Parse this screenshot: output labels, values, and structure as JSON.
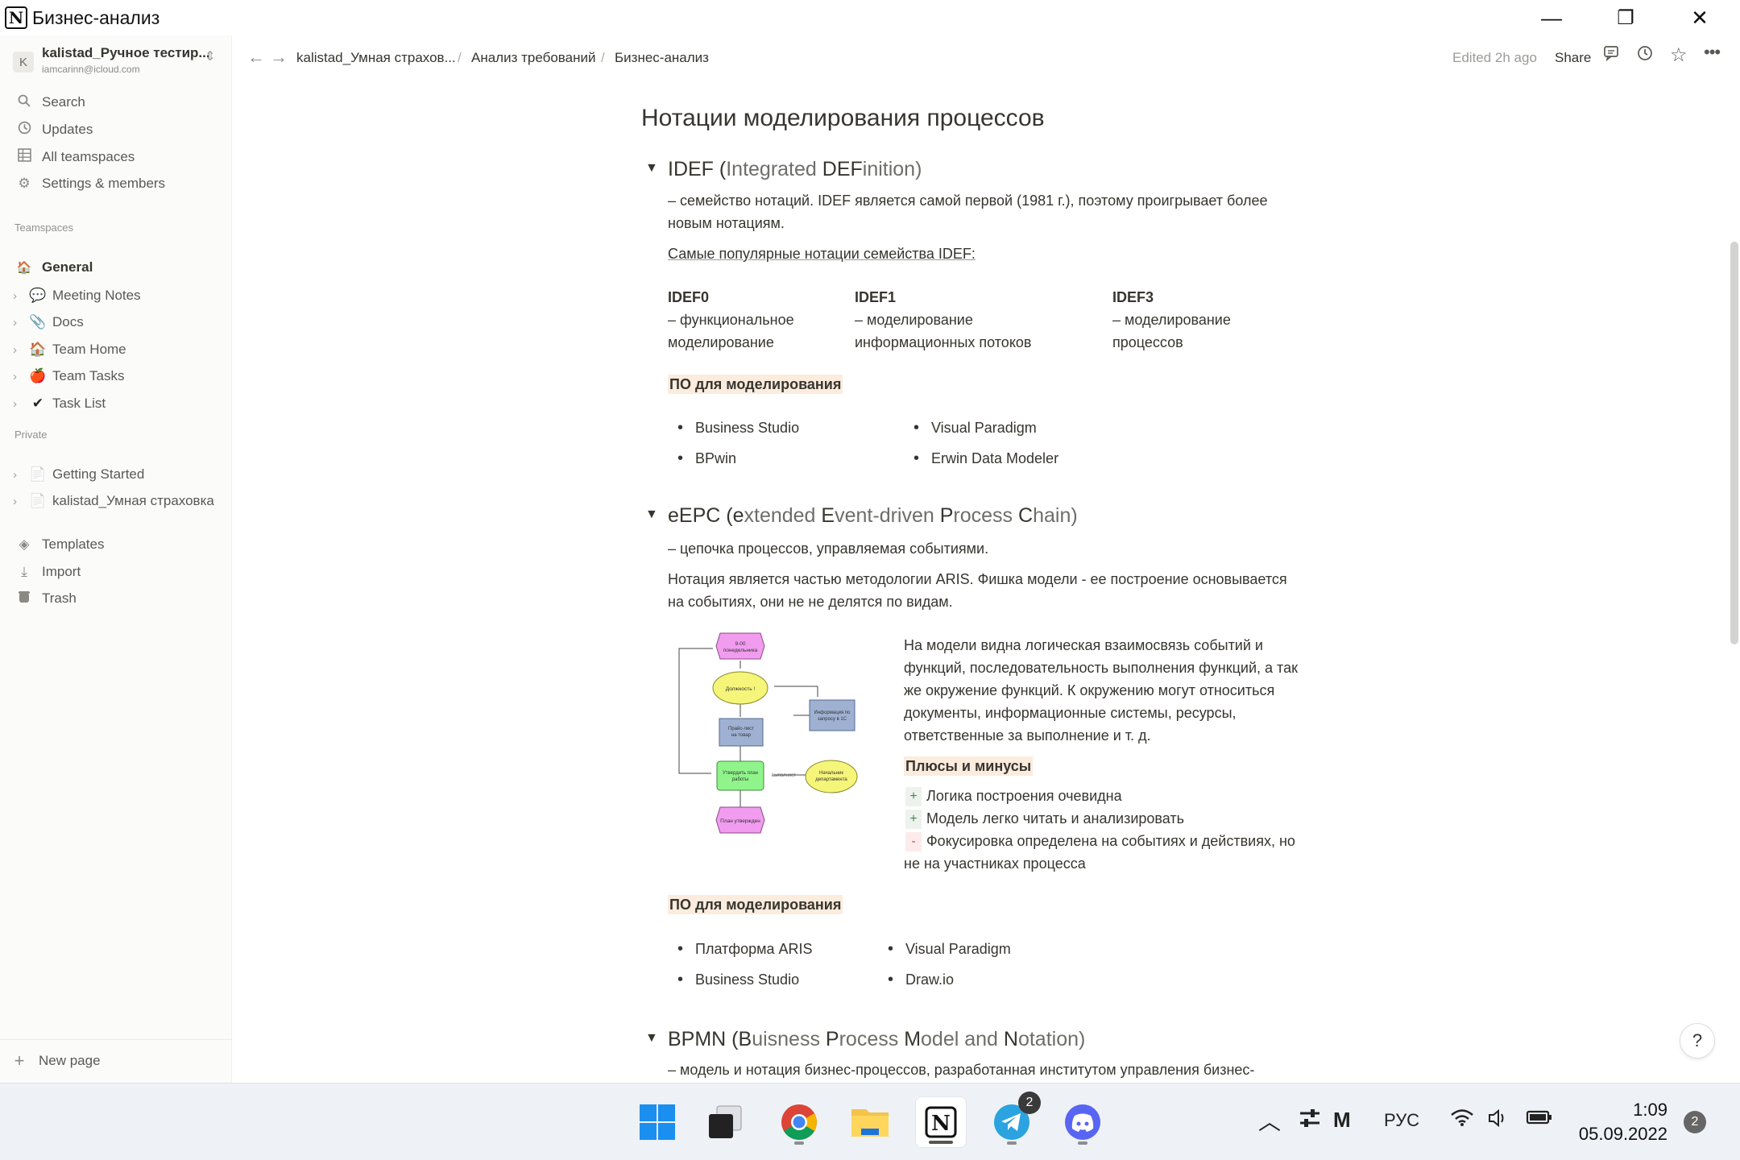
{
  "window": {
    "title": "Бизнес-анализ",
    "minimize": "—",
    "restore": "❐",
    "close": "✕"
  },
  "workspace": {
    "avatar": "K",
    "name": "kalistad_Ручное тестир...",
    "email": "iamcarinn@icloud.com"
  },
  "sidebar": {
    "top_items": [
      {
        "icon": "search-icon",
        "label": "Search"
      },
      {
        "icon": "clock-icon",
        "label": "Updates"
      },
      {
        "icon": "grid-icon",
        "label": "All teamspaces"
      },
      {
        "icon": "gear-icon",
        "label": "Settings & members"
      }
    ],
    "teamspaces_label": "Teamspaces",
    "teamspace_general": "General",
    "teamspace_items": [
      {
        "emoji": "💬",
        "label": "Meeting Notes"
      },
      {
        "emoji": "📎",
        "label": "Docs"
      },
      {
        "emoji": "🏠",
        "label": "Team Home"
      },
      {
        "emoji": "🍎",
        "label": "Team Tasks"
      },
      {
        "emoji": "✔",
        "label": "Task List"
      }
    ],
    "private_label": "Private",
    "private_items": [
      {
        "emoji": "📄",
        "label": "Getting Started"
      },
      {
        "emoji": "📄",
        "label": "kalistad_Умная страховка"
      }
    ],
    "bottom_items": [
      {
        "icon": "templates-icon",
        "label": "Templates"
      },
      {
        "icon": "import-icon",
        "label": "Import"
      },
      {
        "icon": "trash-icon",
        "label": "Trash"
      }
    ],
    "new_page": "New page"
  },
  "topbar": {
    "breadcrumbs": [
      "kalistad_Умная страхов...",
      "Анализ требований",
      "Бизнес-анализ"
    ],
    "edited": "Edited 2h ago",
    "share": "Share"
  },
  "page": {
    "title": "Нотации моделирования процессов",
    "idef": {
      "heading_pre": "IDEF (",
      "heading_i": "I",
      "heading_mid1": "ntegrated ",
      "heading_def": "DEF",
      "heading_end": "inition)",
      "desc1": " – семейство нотаций. IDEF является самой первой (1981 г.), поэтому проигрывает более",
      "desc2": "новым нотациям.",
      "popular": "Самые популярные нотации семейства IDEF:",
      "cols": [
        {
          "name": "IDEF0",
          "l1": " – функциональное",
          "l2": "моделирование"
        },
        {
          "name": "IDEF1",
          "l1": " –  моделирование",
          "l2": "информационных потоков"
        },
        {
          "name": "IDEF3",
          "l1": " – моделирование",
          "l2": "процессов"
        }
      ],
      "software_label": "ПО для моделирования",
      "software": [
        "Business Studio",
        "BPwin",
        "Visual Paradigm",
        "Erwin Data Modeler"
      ]
    },
    "epc": {
      "heading_pre": "eEPC (",
      "h_e": "e",
      "h_xt": "xtended ",
      "h_E": "E",
      "h_vent": "vent-driven ",
      "h_P": "P",
      "h_rocess": "rocess ",
      "h_C": "C",
      "h_hain": "hain)",
      "desc": " – цепочка процессов, управляемая событиями.",
      "note1": " Нотация является частью методологии ARIS. Фишка модели - ее построение основывается",
      "note2": "на событиях, они не не делятся по видам.",
      "side_lines": [
        "На модели видна логическая взаимосвязь событий и",
        "функций, последовательность выполнения функций, а так",
        "же окружение функций. К окружению могут относиться",
        "документы, информационные системы, ресурсы,",
        "ответственные за выполнение и т. д."
      ],
      "pros_cons_label": "Плюсы и минусы",
      "pros": [
        "Логика построения очевидна",
        "Модель легко читать и анализировать"
      ],
      "con1": "Фокусировка определена на событиях и действиях, но",
      "con2": "не на участниках процесса",
      "plus_sign": "+",
      "minus_sign": "-",
      "software_label": "ПО для моделирования",
      "software": [
        "Платформа ARIS",
        "Business Studio",
        "Visual Paradigm",
        "Draw.io"
      ],
      "diagram": {
        "n1": "9-00",
        "n1b": "понедельника",
        "n2": "Должность !",
        "n3": "Прайс-лист",
        "n3b": "на товар",
        "n4": "Информация по",
        "n4b": "запросу в 1С",
        "n5": "Утвердить план",
        "n5b": "работы",
        "n6": "выполняет",
        "n7": "Начальник",
        "n7b": "департамента",
        "n8": "План утвержден"
      }
    },
    "bpmn": {
      "heading_pre": "BPMN (",
      "h_B": "B",
      "h_uisness": "uisness ",
      "h_P": "P",
      "h_rocess": "rocess ",
      "h_M": "M",
      "h_odel": "odel and ",
      "h_N": "N",
      "h_otation": "otation)",
      "desc": "– модель и нотация бизнес-процессов, разработанная институтом управления бизнес-"
    }
  },
  "help": "?",
  "taskbar": {
    "lang": "РУС",
    "time": "1:09",
    "date": "05.09.2022",
    "telegram_badge": "2",
    "notif_badge": "2"
  }
}
